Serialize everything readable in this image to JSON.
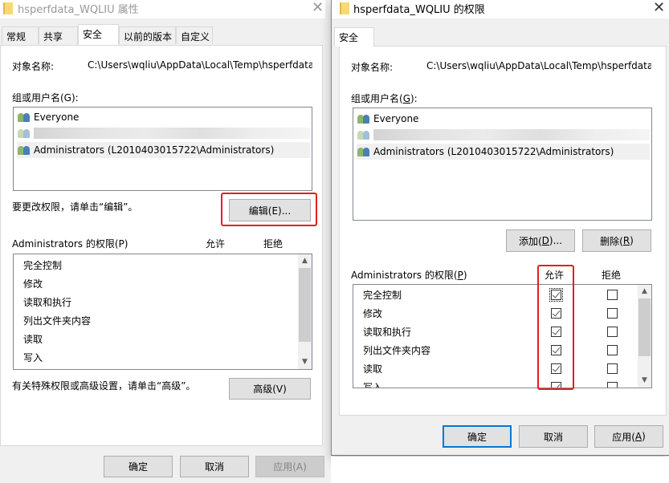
{
  "left_window": {
    "title": "hsperfdata_WQLIU 属性",
    "close_glyph": "✕",
    "tabs": [
      {
        "label": "常规",
        "active": false
      },
      {
        "label": "共享",
        "active": false
      },
      {
        "label": "安全",
        "active": true
      },
      {
        "label": "以前的版本",
        "active": false
      },
      {
        "label": "自定义",
        "active": false
      }
    ],
    "object_name_label": "对象名称:",
    "object_name_value": "C:\\Users\\wqliu\\AppData\\Local\\Temp\\hsperfdata",
    "groups_label": "组或用户名(G):",
    "groups": [
      {
        "name": "Everyone",
        "icon": "users-icon",
        "selected": false,
        "blurred": false
      },
      {
        "name": "",
        "icon": "users-icon",
        "selected": false,
        "blurred": true
      },
      {
        "name": "Administrators (L2010403015722\\Administrators)",
        "icon": "users-icon",
        "selected": true,
        "blurred": false
      }
    ],
    "edit_hint": "要更改权限，请单击“编辑”。",
    "edit_button": "编辑(E)...",
    "perm_label": "Administrators 的权限(P)",
    "allow_header": "允许",
    "deny_header": "拒绝",
    "permissions": [
      "完全控制",
      "修改",
      "读取和执行",
      "列出文件夹内容",
      "读取",
      "写入"
    ],
    "advanced_hint": "有关特殊权限或高级设置，请单击“高级”。",
    "advanced_button": "高级(V)",
    "ok_button": "确定",
    "cancel_button": "取消",
    "apply_button": "应用(A)",
    "apply_enabled": false
  },
  "right_window": {
    "title": "hsperfdata_WQLIU 的权限",
    "close_glyph": "✕",
    "tab": "安全",
    "object_name_label": "对象名称:",
    "object_name_value": "C:\\Users\\wqliu\\AppData\\Local\\Temp\\hsperfdata",
    "groups_label_pre": "组或用户名(",
    "groups_label_key": "G",
    "groups_label_post": "):",
    "groups": [
      {
        "name": "Everyone",
        "icon": "users-icon",
        "selected": false,
        "blurred": false
      },
      {
        "name": "",
        "icon": "users-icon",
        "selected": false,
        "blurred": true
      },
      {
        "name": "Administrators (L2010403015722\\Administrators)",
        "icon": "users-icon",
        "selected": true,
        "blurred": false
      }
    ],
    "add_button_pre": "添加(",
    "add_button_key": "D",
    "add_button_post": ")...",
    "remove_button_pre": "删除(",
    "remove_button_key": "R",
    "remove_button_post": ")",
    "perm_label_pre": "Administrators 的权限(",
    "perm_label_key": "P",
    "perm_label_post": ")",
    "allow_header": "允许",
    "deny_header": "拒绝",
    "permissions": [
      {
        "name": "完全控制",
        "allow": true,
        "deny": false
      },
      {
        "name": "修改",
        "allow": true,
        "deny": false
      },
      {
        "name": "读取和执行",
        "allow": true,
        "deny": false
      },
      {
        "name": "列出文件夹内容",
        "allow": true,
        "deny": false
      },
      {
        "name": "读取",
        "allow": true,
        "deny": false
      },
      {
        "name": "写入",
        "allow": true,
        "deny": false
      }
    ],
    "ok_button": "确定",
    "cancel_button": "取消",
    "apply_button_pre": "应用(",
    "apply_button_key": "A",
    "apply_button_post": ")"
  },
  "annotations": {
    "highlight_color": "#e02020"
  }
}
